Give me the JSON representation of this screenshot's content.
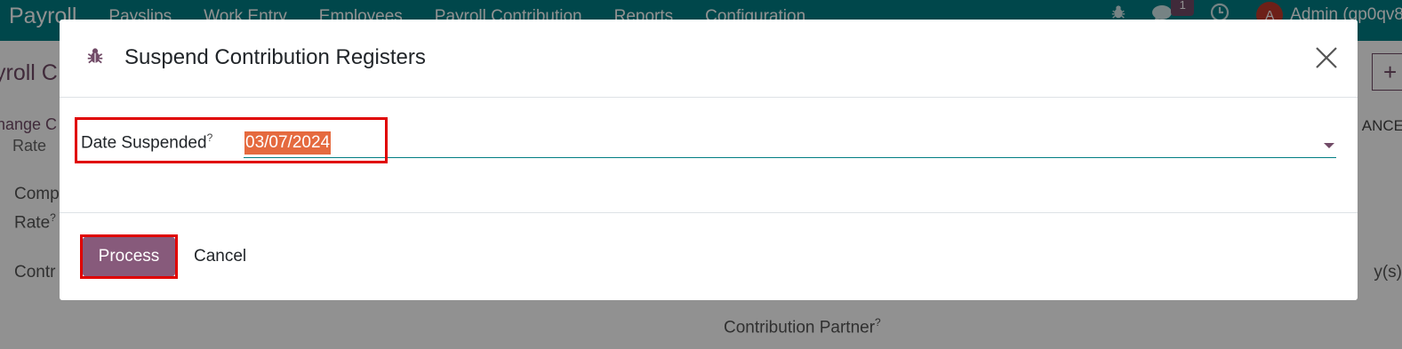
{
  "navbar": {
    "brand": "Payroll",
    "menu": [
      "Payslips",
      "Work Entry",
      "Employees",
      "Payroll Contribution",
      "Reports",
      "Configuration"
    ],
    "message_count": "1",
    "avatar_letter": "A",
    "user": "Admin (gp0qv8"
  },
  "background": {
    "title": "yroll C",
    "change": "hange C",
    "cancel": "ANCE",
    "rate_top": "Rate",
    "comp": "Comp",
    "rate": "Rate",
    "contr": "Contr",
    "days": "y(s)",
    "partner": "Contribution Partner"
  },
  "modal": {
    "title": "Suspend Contribution Registers",
    "field_label": "Date Suspended",
    "field_help": "?",
    "date_value": "03/07/2024",
    "process_label": "Process",
    "cancel_label": "Cancel"
  },
  "colors": {
    "navbar": "#017e84",
    "primary": "#875a7b",
    "selection": "#e56a3f",
    "highlight": "#e00000"
  }
}
